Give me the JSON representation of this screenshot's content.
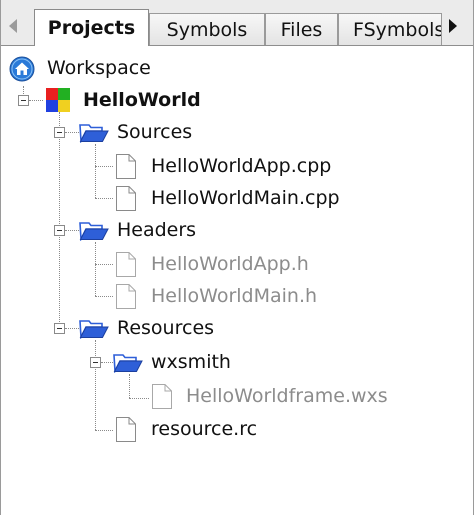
{
  "tabs": {
    "items": [
      {
        "label": "Projects",
        "active": true
      },
      {
        "label": "Symbols",
        "active": false
      },
      {
        "label": "Files",
        "active": false
      },
      {
        "label": "FSymbols",
        "active": false
      }
    ]
  },
  "tree": {
    "workspace": {
      "label": "Workspace",
      "icon": "workspace-home-icon"
    },
    "project": {
      "label": "HelloWorld",
      "icon": "project-icon"
    },
    "sources": {
      "label": "Sources",
      "icon": "folder-open-icon",
      "files": [
        "HelloWorldApp.cpp",
        "HelloWorldMain.cpp"
      ]
    },
    "headers": {
      "label": "Headers",
      "icon": "folder-open-icon",
      "files": [
        "HelloWorldApp.h",
        "HelloWorldMain.h"
      ]
    },
    "resources": {
      "label": "Resources",
      "icon": "folder-open-icon",
      "wxsmith": {
        "label": "wxsmith",
        "icon": "folder-open-icon",
        "files": [
          "HelloWorldframe.wxs"
        ]
      },
      "files": [
        "resource.rc"
      ]
    }
  },
  "colors": {
    "folder_blue": "#2e5fd8",
    "workspace_blue": "#2a7ad8",
    "dimmed_text": "#8c8c8c",
    "tab_bar": "#ebebeb"
  }
}
